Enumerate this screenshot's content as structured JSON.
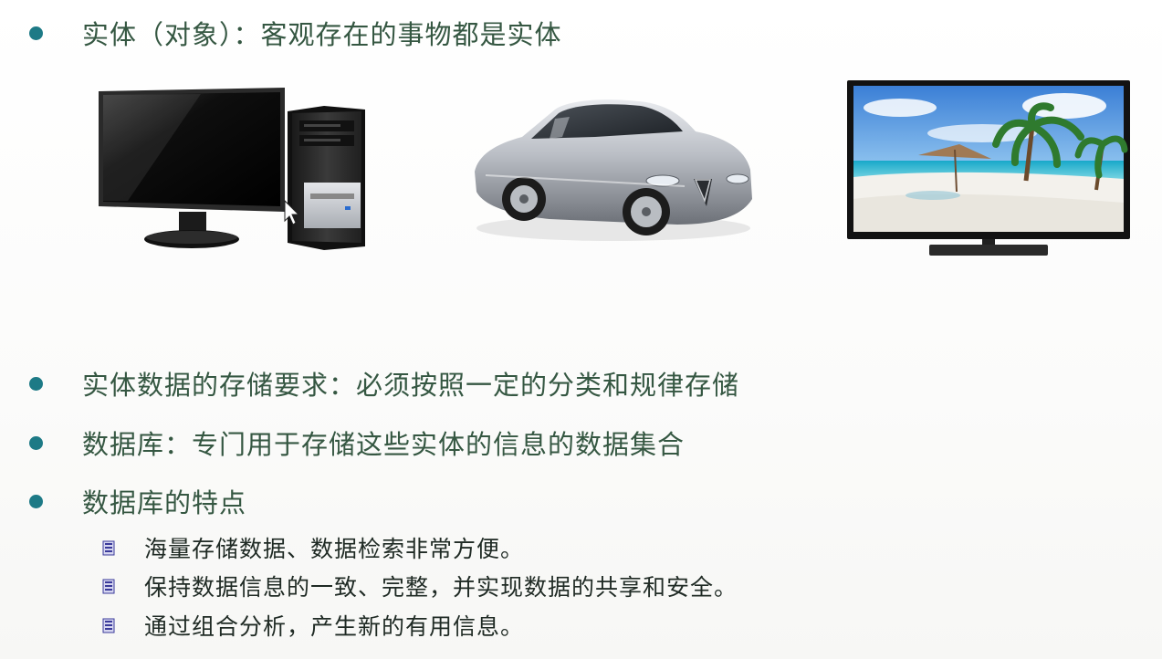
{
  "bullets": [
    {
      "text": "实体（对象）：客观存在的事物都是实体"
    },
    {
      "text": "实体数据的存储要求：必须按照一定的分类和规律存储"
    },
    {
      "text": "数据库：专门用于存储这些实体的信息的数据集合"
    },
    {
      "text": "数据库的特点"
    }
  ],
  "sub_bullets": [
    {
      "text": "海量存储数据、数据检索非常方便。"
    },
    {
      "text": "保持数据信息的一致、完整，并实现数据的共享和安全。"
    },
    {
      "text": "通过组合分析，产生新的有用信息。"
    }
  ],
  "images": {
    "computer": "desktop-computer-picture",
    "car": "car-picture",
    "tv": "television-picture"
  },
  "colors": {
    "bullet_dot": "#1d7a86",
    "bullet_text": "#355742",
    "sub_icon": "#3a3a9a"
  }
}
